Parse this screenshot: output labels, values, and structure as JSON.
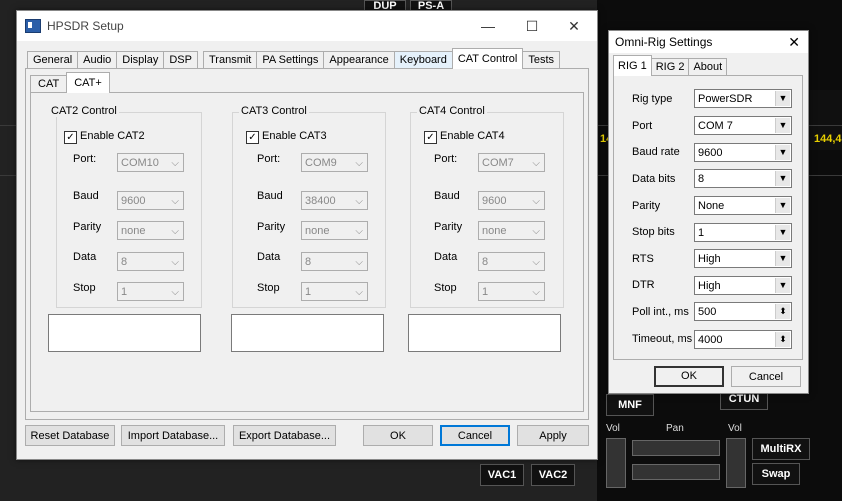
{
  "background": {
    "ghost_buttons": [
      "DUP",
      "PS-A",
      "MNF",
      "CTUN",
      "MultiRX",
      "Swap",
      "VAC1",
      "VAC2"
    ],
    "freq_left": "14",
    "freq_right": "144,4",
    "labels": {
      "vol1": "Vol",
      "pan": "Pan",
      "vol2": "Vol"
    }
  },
  "hpsdr": {
    "title": "HPSDR Setup",
    "controls": {
      "minimize": "—",
      "maximize": "☐",
      "close": "✕"
    },
    "tabs": [
      "General",
      "Audio",
      "Display",
      "DSP",
      "Transmit",
      "PA Settings",
      "Appearance",
      "Keyboard",
      "CAT Control",
      "Tests"
    ],
    "active_tab": "CAT Control",
    "subtabs": [
      "CAT",
      "CAT+"
    ],
    "active_subtab": "CAT+",
    "groups": [
      {
        "title": "CAT2 Control",
        "enable_label": "Enable CAT2",
        "checked": true,
        "port_label": "Port:",
        "port": "COM10",
        "baud_label": "Baud",
        "baud": "9600",
        "parity_label": "Parity",
        "parity": "none",
        "data_label": "Data",
        "data": "8",
        "stop_label": "Stop",
        "stop": "1"
      },
      {
        "title": "CAT3 Control",
        "enable_label": "Enable CAT3",
        "checked": true,
        "port_label": "Port:",
        "port": "COM9",
        "baud_label": "Baud",
        "baud": "38400",
        "parity_label": "Parity",
        "parity": "none",
        "data_label": "Data",
        "data": "8",
        "stop_label": "Stop",
        "stop": "1"
      },
      {
        "title": "CAT4 Control",
        "enable_label": "Enable CAT4",
        "checked": true,
        "port_label": "Port:",
        "port": "COM7",
        "baud_label": "Baud",
        "baud": "9600",
        "parity_label": "Parity",
        "parity": "none",
        "data_label": "Data",
        "data": "8",
        "stop_label": "Stop",
        "stop": "1"
      }
    ],
    "buttons": {
      "reset": "Reset Database",
      "import": "Import Database...",
      "export": "Export Database...",
      "ok": "OK",
      "cancel": "Cancel",
      "apply": "Apply"
    }
  },
  "omni": {
    "title": "Omni-Rig Settings",
    "close": "✕",
    "tabs": [
      "RIG 1",
      "RIG 2",
      "About"
    ],
    "active_tab": "RIG 1",
    "fields": [
      {
        "label": "Rig type",
        "value": "PowerSDR",
        "kind": "combo"
      },
      {
        "label": "Port",
        "value": "COM 7",
        "kind": "combo"
      },
      {
        "label": "Baud rate",
        "value": "9600",
        "kind": "combo"
      },
      {
        "label": "Data bits",
        "value": "8",
        "kind": "combo"
      },
      {
        "label": "Parity",
        "value": "None",
        "kind": "combo"
      },
      {
        "label": "Stop bits",
        "value": "1",
        "kind": "combo"
      },
      {
        "label": "RTS",
        "value": "High",
        "kind": "combo"
      },
      {
        "label": "DTR",
        "value": "High",
        "kind": "combo"
      },
      {
        "label": "Poll int., ms",
        "value": "500",
        "kind": "spin"
      },
      {
        "label": "Timeout, ms",
        "value": "4000",
        "kind": "spin"
      }
    ],
    "ok": "OK",
    "cancel": "Cancel"
  }
}
